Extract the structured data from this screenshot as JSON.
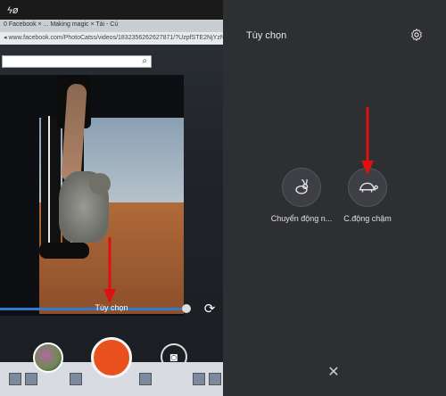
{
  "left_screen": {
    "status_text": "ϟø",
    "browser": {
      "tabs_text": "0 Facebook   ×   ...   Making magic ×   Tài - Cú",
      "url_text": "◂ www.facebook.com/PhotoCatss/videos/1832356262627871/?UzpfSTE2NjYzNjY",
      "search_icon": "⌕"
    },
    "video_progress": 0.97,
    "options_label": "Tùy chọn",
    "rotate_icon": "⟳",
    "camera_icon": "◙"
  },
  "right_panel": {
    "title": "Tùy chọn",
    "options": [
      {
        "label": "Chuyển động n...",
        "icon": "rabbit-icon"
      },
      {
        "label": "C.động chậm",
        "icon": "turtle-icon"
      }
    ],
    "close_glyph": "✕"
  },
  "colors": {
    "shutter": "#e8501e",
    "annotation_arrow": "#e01010",
    "panel_bg": "#2e2f33"
  }
}
